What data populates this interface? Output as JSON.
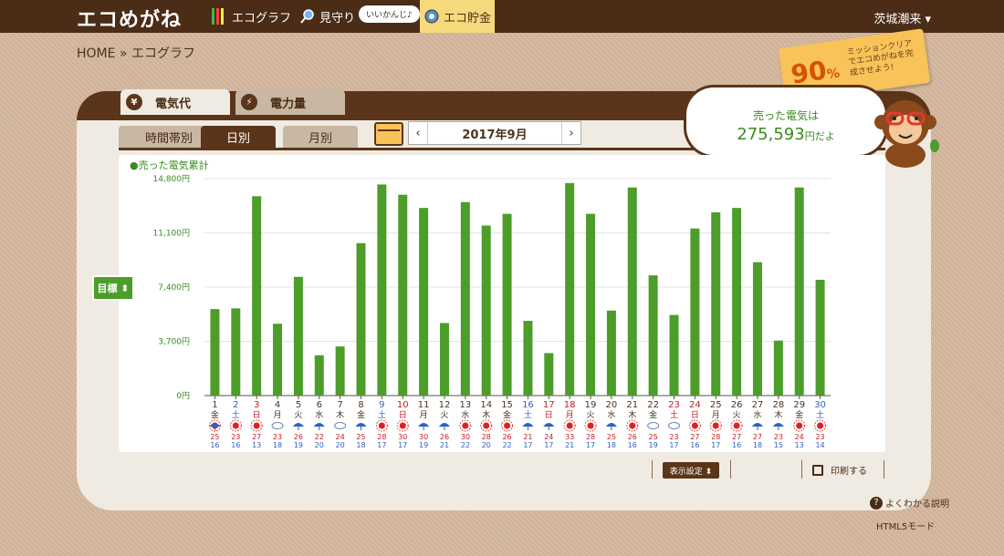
{
  "header": {
    "logo": "エコめがね",
    "nav": [
      {
        "label": "エコグラフ"
      },
      {
        "label": "見守り"
      },
      {
        "label": "エコ貯金"
      }
    ],
    "bubble": "いいかんじ♪",
    "user": "茨城潮来 ▾"
  },
  "breadcrumb": {
    "home": "HOME",
    "sep": "»",
    "current": "エコグラフ"
  },
  "mission": {
    "percent": "90",
    "unit": "%",
    "text": "ミッションクリアでエコめがねを完成させよう!"
  },
  "tabs": {
    "denki": "電気代",
    "power": "電力量",
    "denki_icon": "¥",
    "power_icon": "⚡"
  },
  "subtabs": {
    "time": "時間帯別",
    "day": "日別",
    "month": "月別"
  },
  "date": {
    "prev": "‹",
    "value": "2017年9月",
    "next": "›"
  },
  "sold": {
    "line1": "売った電気は",
    "value": "275,593",
    "suffix": "円だよ"
  },
  "legend": "●売った電気累計",
  "goal_button": "目標 ⬍",
  "controls": {
    "display": "表示設定 ⬍",
    "print": "印刷する",
    "help": "よくわかる説明",
    "html5": "HTML5モード"
  },
  "colors": {
    "bar": "#4c9d2a",
    "saturday": "#2a62c9",
    "sunday": "#c91a1a",
    "weekday": "#4a3320",
    "high": "#c91a1a",
    "low": "#2a62c9"
  },
  "chart_data": {
    "type": "bar",
    "ylim": [
      0,
      14800
    ],
    "yticks": [
      "14,800円",
      "11,100円",
      "7,400円",
      "3,700円",
      "0円"
    ],
    "ytick_values": [
      14800,
      11100,
      7400,
      3700,
      0
    ],
    "days": [
      {
        "d": "1",
        "w": "金",
        "v": 5900,
        "wx": "sun-rain",
        "hi": "25",
        "lo": "16",
        "c": "weekday"
      },
      {
        "d": "2",
        "w": "土",
        "v": 5950,
        "wx": "sun",
        "hi": "23",
        "lo": "16",
        "c": "saturday"
      },
      {
        "d": "3",
        "w": "日",
        "v": 13600,
        "wx": "sun",
        "hi": "27",
        "lo": "13",
        "c": "sunday"
      },
      {
        "d": "4",
        "w": "月",
        "v": 4900,
        "wx": "cloud",
        "hi": "23",
        "lo": "18",
        "c": "weekday"
      },
      {
        "d": "5",
        "w": "火",
        "v": 8100,
        "wx": "rain",
        "hi": "26",
        "lo": "19",
        "c": "weekday"
      },
      {
        "d": "6",
        "w": "水",
        "v": 2750,
        "wx": "rain",
        "hi": "22",
        "lo": "20",
        "c": "weekday"
      },
      {
        "d": "7",
        "w": "木",
        "v": 3350,
        "wx": "cloud",
        "hi": "24",
        "lo": "20",
        "c": "weekday"
      },
      {
        "d": "8",
        "w": "金",
        "v": 10400,
        "wx": "rain",
        "hi": "25",
        "lo": "18",
        "c": "weekday"
      },
      {
        "d": "9",
        "w": "土",
        "v": 14400,
        "wx": "sun",
        "hi": "28",
        "lo": "17",
        "c": "saturday"
      },
      {
        "d": "10",
        "w": "日",
        "v": 13700,
        "wx": "sun",
        "hi": "30",
        "lo": "17",
        "c": "sunday"
      },
      {
        "d": "11",
        "w": "月",
        "v": 12800,
        "wx": "rain",
        "hi": "30",
        "lo": "19",
        "c": "weekday"
      },
      {
        "d": "12",
        "w": "火",
        "v": 4950,
        "wx": "rain",
        "hi": "26",
        "lo": "21",
        "c": "weekday"
      },
      {
        "d": "13",
        "w": "水",
        "v": 13200,
        "wx": "sun",
        "hi": "30",
        "lo": "22",
        "c": "weekday"
      },
      {
        "d": "14",
        "w": "木",
        "v": 11600,
        "wx": "sun",
        "hi": "28",
        "lo": "20",
        "c": "weekday"
      },
      {
        "d": "15",
        "w": "金",
        "v": 12400,
        "wx": "sun",
        "hi": "26",
        "lo": "22",
        "c": "weekday"
      },
      {
        "d": "16",
        "w": "土",
        "v": 5100,
        "wx": "rain",
        "hi": "21",
        "lo": "17",
        "c": "saturday"
      },
      {
        "d": "17",
        "w": "日",
        "v": 2900,
        "wx": "rain",
        "hi": "24",
        "lo": "17",
        "c": "sunday"
      },
      {
        "d": "18",
        "w": "月",
        "v": 14500,
        "wx": "sun",
        "hi": "33",
        "lo": "21",
        "c": "sunday"
      },
      {
        "d": "19",
        "w": "火",
        "v": 12400,
        "wx": "sun",
        "hi": "28",
        "lo": "17",
        "c": "weekday"
      },
      {
        "d": "20",
        "w": "水",
        "v": 5800,
        "wx": "rain",
        "hi": "25",
        "lo": "18",
        "c": "weekday"
      },
      {
        "d": "21",
        "w": "木",
        "v": 14200,
        "wx": "sun",
        "hi": "26",
        "lo": "16",
        "c": "weekday"
      },
      {
        "d": "22",
        "w": "金",
        "v": 8200,
        "wx": "cloud",
        "hi": "25",
        "lo": "19",
        "c": "weekday"
      },
      {
        "d": "23",
        "w": "土",
        "v": 5500,
        "wx": "cloud",
        "hi": "23",
        "lo": "17",
        "c": "sunday"
      },
      {
        "d": "24",
        "w": "日",
        "v": 11400,
        "wx": "sun",
        "hi": "27",
        "lo": "16",
        "c": "sunday"
      },
      {
        "d": "25",
        "w": "月",
        "v": 12500,
        "wx": "sun",
        "hi": "28",
        "lo": "17",
        "c": "weekday"
      },
      {
        "d": "26",
        "w": "火",
        "v": 12800,
        "wx": "sun",
        "hi": "27",
        "lo": "16",
        "c": "weekday"
      },
      {
        "d": "27",
        "w": "水",
        "v": 9100,
        "wx": "rain",
        "hi": "27",
        "lo": "18",
        "c": "weekday"
      },
      {
        "d": "28",
        "w": "木",
        "v": 3750,
        "wx": "rain",
        "hi": "23",
        "lo": "15",
        "c": "weekday"
      },
      {
        "d": "29",
        "w": "金",
        "v": 14200,
        "wx": "sun",
        "hi": "24",
        "lo": "13",
        "c": "weekday"
      },
      {
        "d": "30",
        "w": "土",
        "v": 7900,
        "wx": "sun",
        "hi": "23",
        "lo": "14",
        "c": "saturday"
      }
    ]
  }
}
